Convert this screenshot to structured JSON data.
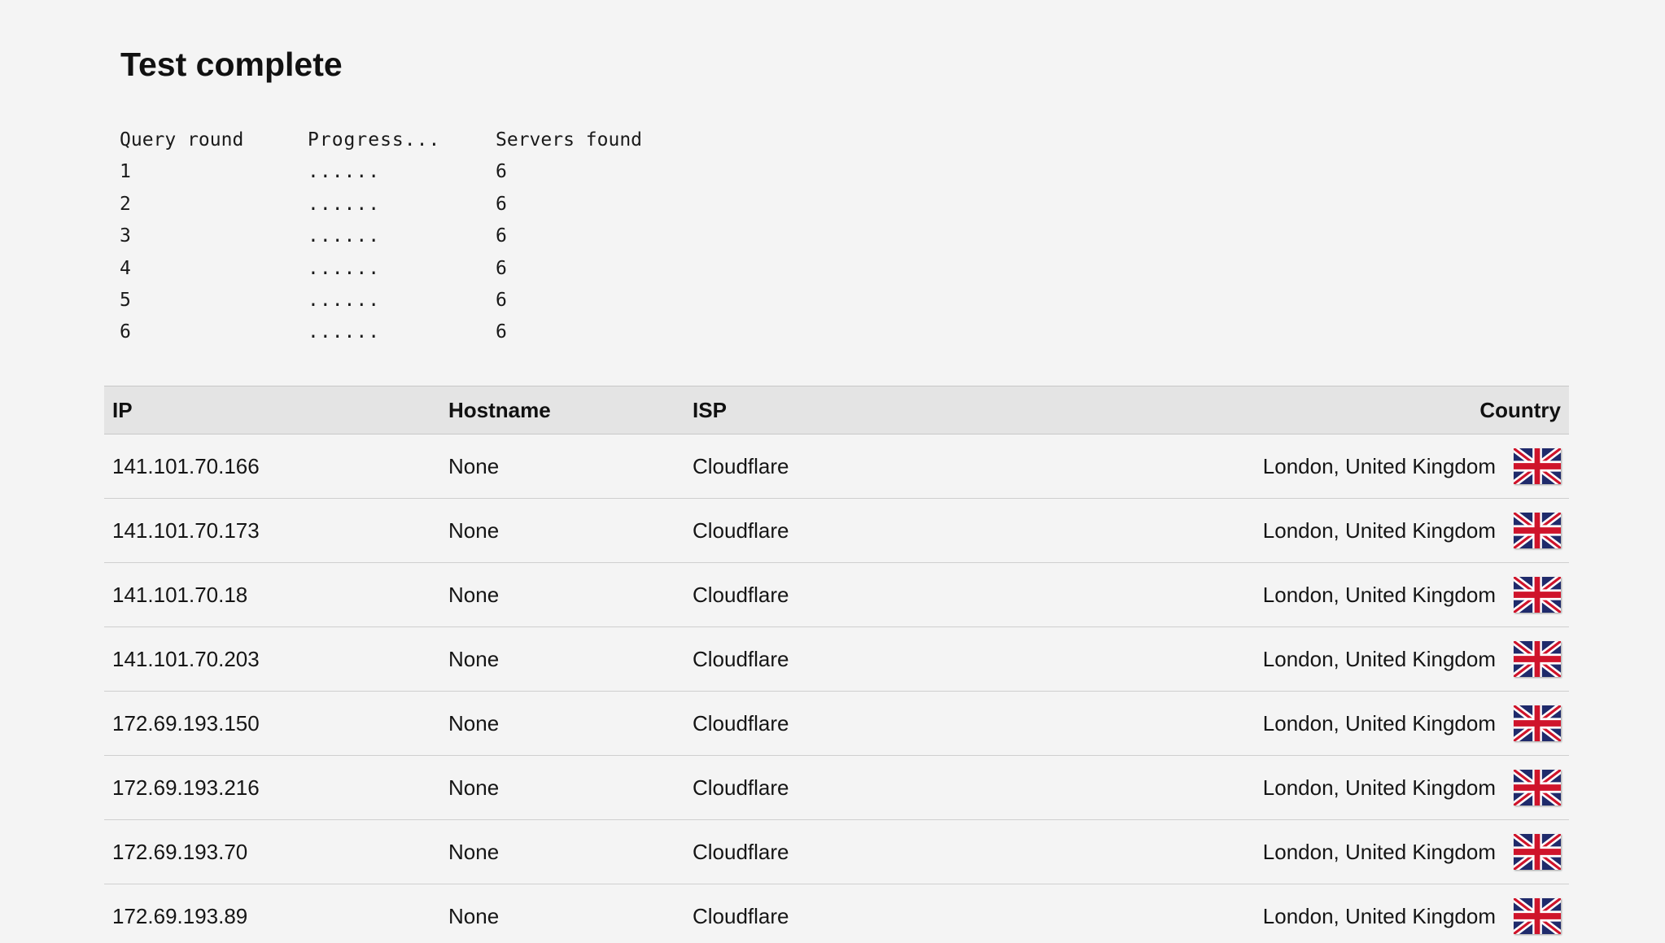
{
  "page": {
    "title": "Test complete"
  },
  "query_rounds": {
    "headers": [
      "Query round",
      "Progress...",
      "Servers found"
    ],
    "rows": [
      {
        "round": "1",
        "progress": "......",
        "servers": "6"
      },
      {
        "round": "2",
        "progress": "......",
        "servers": "6"
      },
      {
        "round": "3",
        "progress": "......",
        "servers": "6"
      },
      {
        "round": "4",
        "progress": "......",
        "servers": "6"
      },
      {
        "round": "5",
        "progress": "......",
        "servers": "6"
      },
      {
        "round": "6",
        "progress": "......",
        "servers": "6"
      }
    ]
  },
  "results_table": {
    "headers": {
      "ip": "IP",
      "hostname": "Hostname",
      "isp": "ISP",
      "country": "Country"
    },
    "rows": [
      {
        "ip": "141.101.70.166",
        "hostname": "None",
        "isp": "Cloudflare",
        "location": "London, United Kingdom",
        "flag": "uk-flag-icon"
      },
      {
        "ip": "141.101.70.173",
        "hostname": "None",
        "isp": "Cloudflare",
        "location": "London, United Kingdom",
        "flag": "uk-flag-icon"
      },
      {
        "ip": "141.101.70.18",
        "hostname": "None",
        "isp": "Cloudflare",
        "location": "London, United Kingdom",
        "flag": "uk-flag-icon"
      },
      {
        "ip": "141.101.70.203",
        "hostname": "None",
        "isp": "Cloudflare",
        "location": "London, United Kingdom",
        "flag": "uk-flag-icon"
      },
      {
        "ip": "172.69.193.150",
        "hostname": "None",
        "isp": "Cloudflare",
        "location": "London, United Kingdom",
        "flag": "uk-flag-icon"
      },
      {
        "ip": "172.69.193.216",
        "hostname": "None",
        "isp": "Cloudflare",
        "location": "London, United Kingdom",
        "flag": "uk-flag-icon"
      },
      {
        "ip": "172.69.193.70",
        "hostname": "None",
        "isp": "Cloudflare",
        "location": "London, United Kingdom",
        "flag": "uk-flag-icon"
      },
      {
        "ip": "172.69.193.89",
        "hostname": "None",
        "isp": "Cloudflare",
        "location": "London, United Kingdom",
        "flag": "uk-flag-icon"
      }
    ]
  },
  "colors": {
    "background": "#f4f4f4",
    "header_row": "#e4e4e4",
    "flag_blue": "#1f2a6b",
    "flag_red": "#cf142b"
  }
}
